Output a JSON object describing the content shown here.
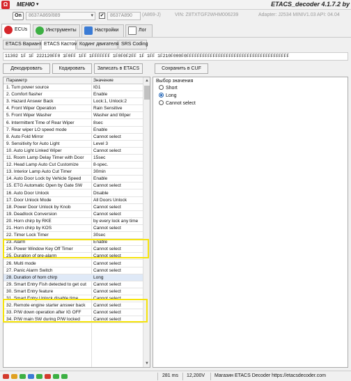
{
  "window": {
    "menu_label": "МЕНЮ",
    "menu_caret": "▾",
    "title": "ETACS_decoder 4.1.7.2 by",
    "logo_glyph": "Ω"
  },
  "toolbar": {
    "on_label": "On",
    "combo1_value": "8637A869/889",
    "combo2_value": "8637A890",
    "combo2_sub": "(A869-J)",
    "vin_label": "VIN: Z8TXTGF2WHM006239",
    "adapter_label": "Adapter: J2534 MINIV1.03 API: 04.04",
    "check_glyph": "✔"
  },
  "tabs": [
    {
      "label": "ECUs",
      "icon": "mitsubishi-icon"
    },
    {
      "label": "Инструменты",
      "icon": "tools-icon"
    },
    {
      "label": "Настройки",
      "icon": "settings-icon"
    },
    {
      "label": "Лог",
      "icon": "log-icon"
    }
  ],
  "subtabs": [
    {
      "label": "ETACS Вариант"
    },
    {
      "label": "ETACS Кастом"
    },
    {
      "label": "Кодинг двигателя"
    },
    {
      "label": "SRS Coding"
    }
  ],
  "hex_value": "11302 1F 1F 222120FF0 1F0FF 1FF 1FFFFFFF 1F0F0F2FF 1F 1FF 1F210F000F0FFFFFFFFFFFFFFFFFFFFFFFFFFFFFFFFFFFFFFF",
  "actions": {
    "decode": "Декодировать",
    "encode": "Кодировать",
    "write": "Записать в ETACS",
    "save": "Сохранить в CUF"
  },
  "table": {
    "col_param": "Параметр",
    "col_value": "Значение",
    "rows": [
      {
        "param": "1. Turn power source",
        "value": "IG1"
      },
      {
        "param": "2. Comfort flasher",
        "value": "Enable"
      },
      {
        "param": "3. Hazard Answer Back",
        "value": "Lock:1, Unlock:2"
      },
      {
        "param": "4. Front Wiper Operation",
        "value": "Rain Sensitive"
      },
      {
        "param": "5. Front Wiper Washer",
        "value": "Washer and Wiper"
      },
      {
        "param": "6. Intermittent Time of Rear Wiper",
        "value": "8sec"
      },
      {
        "param": "7. Rear wiper LO speed mode",
        "value": "Enable"
      },
      {
        "param": "8. Auto Fold Mirror",
        "value": "Cannot select"
      },
      {
        "param": "9. Sensitivity for Auto Light",
        "value": "Level 3"
      },
      {
        "param": "10. Auto Light Linked Wiper",
        "value": "Cannot select"
      },
      {
        "param": "11. Room Lamp Delay Timer with Door",
        "value": "15sec"
      },
      {
        "param": "12. Head Lamp Auto Cut Customize",
        "value": "8-spec."
      },
      {
        "param": "13. Interior Lamp Auto Cut Timer",
        "value": "30min"
      },
      {
        "param": "14. Auto Door Lock by Vehicle Speed",
        "value": "Enable"
      },
      {
        "param": "15. ETG Automatic Open by Gate SW",
        "value": "Cannot select"
      },
      {
        "param": "16. Auto Door Unlock",
        "value": "Disable"
      },
      {
        "param": "17. Door Unlock Mode",
        "value": "All Doors Unlock"
      },
      {
        "param": "18. Power Door Unlock by Knob",
        "value": "Cannot select"
      },
      {
        "param": "19. Deadlock Conversion",
        "value": "Cannot select"
      },
      {
        "param": "20. Horn chirp by RKE",
        "value": "by every lock any time"
      },
      {
        "param": "21. Horn chirp by KOS",
        "value": "Cannot select"
      },
      {
        "param": "22. Timer Lock Timer",
        "value": "30sec"
      },
      {
        "param": "23. Alarm",
        "value": "Enable"
      },
      {
        "param": "24. Power Window Key Off Timer",
        "value": "Cannot select"
      },
      {
        "param": "25. Duration of pre-alarm",
        "value": "Cannot select"
      },
      {
        "param": "26. Multi mode",
        "value": "Cannot select"
      },
      {
        "param": "27. Panic Alarm Switch",
        "value": "Cannot select"
      },
      {
        "param": "28. Duration of horn chirp",
        "value": "Long"
      },
      {
        "param": "29. Smart Entry Fish detected to get out",
        "value": "Cannot select"
      },
      {
        "param": "30. Smart Entry feature",
        "value": "Cannot select"
      },
      {
        "param": "31. Smart Entry Unlock disable time",
        "value": "Cannot select"
      },
      {
        "param": "32. Remote engine starter answer back",
        "value": "Cannot select"
      },
      {
        "param": "33. P/W down operation after IG OFF",
        "value": "Cannot select"
      },
      {
        "param": "34. P/W main SW during P/W locked",
        "value": "Cannot select"
      }
    ]
  },
  "choice": {
    "title": "Выбор значения",
    "options": [
      "Short",
      "Long",
      "Cannot select"
    ],
    "selected": "Long"
  },
  "status": {
    "time": "281 ms",
    "voltage": "12,200V",
    "shop": "Магазин ETACS Decoder https://etacsdecoder.com",
    "led_colors": [
      "#d33a2c",
      "#e0a020",
      "#3cb043",
      "#3a7bd5",
      "#3cb043",
      "#d33a2c",
      "#3cb043",
      "#3cb043"
    ]
  },
  "colors": {
    "highlight": "#f5e30b",
    "accent": "#1a5fb4",
    "brand": "#d6262b"
  }
}
